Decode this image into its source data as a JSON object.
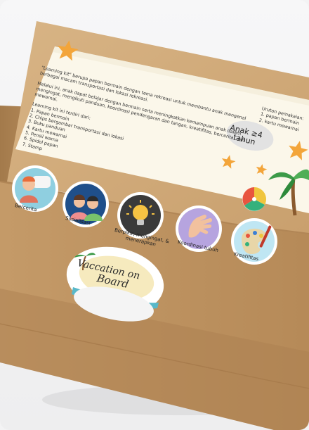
{
  "info_card": {
    "intro": "\"Learning kit\" berupa papan bermain dengan tema rekreasi untuk membantu anak mengenal berbagai macam transportasi dan lokasi rekreasi.",
    "benefit": "Melalui ini, anak dapat belajar dengan bermain serta meningkatkan kemampuan anak dalam mengingat, mengikuti panduan, koordinasi pendengaran dan tangan, kreatifitas, bercerita, dan mewarnai.",
    "list_heading": "Learning kit ini terdiri dari:",
    "items": [
      "1. Papan bermain",
      "2. Chips bergambar transportasi dan lokasi",
      "3. Buku panduan",
      "4. Kartu mewarnai",
      "5. Pensil warna",
      "6. Spidol papan",
      "7. Stamp"
    ],
    "usage_heading": "Urutan pemakaian:",
    "usage_items": [
      "1. papan bermain",
      "2. kartu mewarnai"
    ],
    "age_badge": "Anak ≥4 tahun"
  },
  "skills": [
    {
      "label": "Bercerita",
      "icon": "storytelling-icon"
    },
    {
      "label": "Sosialisasi",
      "icon": "socialization-icon"
    },
    {
      "label": "Berpikir, mengingat, & menerapkan",
      "icon": "lightbulb-icon"
    },
    {
      "label": "Koordinasi tubuh",
      "icon": "hand-icon"
    },
    {
      "label": "Kreatifitas",
      "icon": "palette-icon"
    }
  ],
  "logo": {
    "line1": "Vaccation on",
    "line2": "Board"
  },
  "colors": {
    "cardboard": "#c8a172",
    "label_bg": "#fbf7ea",
    "star": "#f3a53a",
    "accent_palm": "#3c9a48"
  }
}
